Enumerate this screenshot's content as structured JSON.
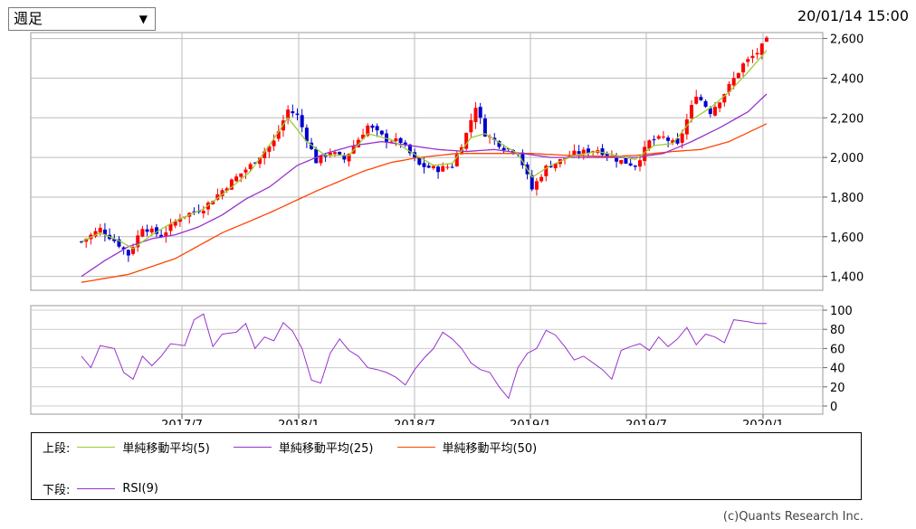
{
  "controls": {
    "period_select": "週足",
    "timestamp": "20/01/14 15:00"
  },
  "legend": {
    "upper_label": "上段:",
    "lower_label": "下段:",
    "items_upper": [
      {
        "label": "単純移動平均(5)",
        "color": "#9acd32"
      },
      {
        "label": "単純移動平均(25)",
        "color": "#9932cc"
      },
      {
        "label": "単純移動平均(50)",
        "color": "#ff4500"
      }
    ],
    "items_lower": [
      {
        "label": "RSI(9)",
        "color": "#9932cc"
      }
    ]
  },
  "copyright": "(c)Quants Research Inc.",
  "chart_data": [
    {
      "type": "candlestick",
      "ylim": [
        1330,
        2630
      ],
      "y_ticks": [
        "2,600",
        "2,400",
        "2,200",
        "2,000",
        "1,800",
        "1,600",
        "1,400"
      ],
      "y_tick_values": [
        2600,
        2400,
        2200,
        2000,
        1800,
        1600,
        1400
      ],
      "x_tick_labels": [
        "2017/7",
        "2018/1",
        "2018/7",
        "2019/1",
        "2019/7",
        "2020/1"
      ],
      "up_color": "#ff0000",
      "down_color": "#0000cd",
      "close_anchors": [
        [
          0,
          1575
        ],
        [
          4,
          1640
        ],
        [
          8,
          1560
        ],
        [
          10,
          1510
        ],
        [
          13,
          1650
        ],
        [
          17,
          1605
        ],
        [
          21,
          1700
        ],
        [
          26,
          1745
        ],
        [
          32,
          1880
        ],
        [
          36,
          1960
        ],
        [
          41,
          2080
        ],
        [
          44,
          2240
        ],
        [
          46,
          2210
        ],
        [
          50,
          1980
        ],
        [
          53,
          2030
        ],
        [
          56,
          1990
        ],
        [
          61,
          2160
        ],
        [
          65,
          2090
        ],
        [
          68,
          2080
        ],
        [
          72,
          1960
        ],
        [
          76,
          1940
        ],
        [
          79,
          1960
        ],
        [
          82,
          2120
        ],
        [
          84,
          2260
        ],
        [
          86,
          2120
        ],
        [
          90,
          2050
        ],
        [
          93,
          2030
        ],
        [
          96,
          1840
        ],
        [
          99,
          1950
        ],
        [
          105,
          2020
        ],
        [
          110,
          2040
        ],
        [
          114,
          1990
        ],
        [
          118,
          1960
        ],
        [
          121,
          2080
        ],
        [
          124,
          2100
        ],
        [
          127,
          2060
        ],
        [
          131,
          2320
        ],
        [
          134,
          2230
        ],
        [
          136,
          2290
        ],
        [
          138,
          2360
        ],
        [
          141,
          2470
        ],
        [
          144,
          2530
        ],
        [
          146,
          2590
        ]
      ],
      "sma5_anchors": [
        [
          0,
          1575
        ],
        [
          4,
          1620
        ],
        [
          8,
          1580
        ],
        [
          11,
          1540
        ],
        [
          15,
          1610
        ],
        [
          20,
          1680
        ],
        [
          26,
          1740
        ],
        [
          32,
          1850
        ],
        [
          36,
          1930
        ],
        [
          40,
          2060
        ],
        [
          44,
          2200
        ],
        [
          48,
          2080
        ],
        [
          52,
          2010
        ],
        [
          57,
          2010
        ],
        [
          61,
          2120
        ],
        [
          66,
          2090
        ],
        [
          70,
          2030
        ],
        [
          75,
          1960
        ],
        [
          79,
          1970
        ],
        [
          83,
          2100
        ],
        [
          86,
          2120
        ],
        [
          90,
          2060
        ],
        [
          93,
          2020
        ],
        [
          96,
          1900
        ],
        [
          100,
          1960
        ],
        [
          105,
          2010
        ],
        [
          110,
          2030
        ],
        [
          114,
          2010
        ],
        [
          118,
          1990
        ],
        [
          122,
          2060
        ],
        [
          126,
          2070
        ],
        [
          130,
          2190
        ],
        [
          134,
          2250
        ],
        [
          138,
          2330
        ],
        [
          142,
          2430
        ],
        [
          146,
          2540
        ]
      ],
      "sma25_anchors": [
        [
          0,
          1400
        ],
        [
          5,
          1480
        ],
        [
          10,
          1550
        ],
        [
          15,
          1590
        ],
        [
          20,
          1610
        ],
        [
          25,
          1650
        ],
        [
          30,
          1710
        ],
        [
          35,
          1790
        ],
        [
          40,
          1850
        ],
        [
          46,
          1960
        ],
        [
          52,
          2020
        ],
        [
          58,
          2060
        ],
        [
          64,
          2080
        ],
        [
          70,
          2060
        ],
        [
          76,
          2040
        ],
        [
          82,
          2030
        ],
        [
          88,
          2040
        ],
        [
          94,
          2020
        ],
        [
          100,
          2000
        ],
        [
          106,
          2000
        ],
        [
          112,
          2000
        ],
        [
          118,
          2000
        ],
        [
          124,
          2020
        ],
        [
          130,
          2080
        ],
        [
          136,
          2150
        ],
        [
          142,
          2230
        ],
        [
          146,
          2320
        ]
      ],
      "sma50_anchors": [
        [
          0,
          1370
        ],
        [
          10,
          1410
        ],
        [
          20,
          1490
        ],
        [
          30,
          1620
        ],
        [
          40,
          1720
        ],
        [
          50,
          1830
        ],
        [
          60,
          1930
        ],
        [
          66,
          1975
        ],
        [
          72,
          2000
        ],
        [
          80,
          2020
        ],
        [
          88,
          2020
        ],
        [
          96,
          2020
        ],
        [
          104,
          2010
        ],
        [
          112,
          2005
        ],
        [
          118,
          2010
        ],
        [
          126,
          2030
        ],
        [
          132,
          2040
        ],
        [
          138,
          2080
        ],
        [
          146,
          2170
        ]
      ]
    },
    {
      "type": "line",
      "name": "RSI(9)",
      "ylim": [
        0,
        100
      ],
      "y_ticks": [
        "100",
        "80",
        "60",
        "40",
        "20",
        "0"
      ],
      "y_tick_values": [
        100,
        80,
        60,
        40,
        20,
        0
      ],
      "values_anchors": [
        [
          0,
          52
        ],
        [
          2,
          40
        ],
        [
          4,
          63
        ],
        [
          7,
          60
        ],
        [
          9,
          35
        ],
        [
          11,
          28
        ],
        [
          13,
          52
        ],
        [
          15,
          42
        ],
        [
          17,
          52
        ],
        [
          19,
          65
        ],
        [
          22,
          63
        ],
        [
          24,
          90
        ],
        [
          26,
          96
        ],
        [
          28,
          62
        ],
        [
          30,
          75
        ],
        [
          33,
          77
        ],
        [
          35,
          86
        ],
        [
          37,
          60
        ],
        [
          39,
          72
        ],
        [
          41,
          68
        ],
        [
          43,
          87
        ],
        [
          45,
          78
        ],
        [
          47,
          60
        ],
        [
          49,
          27
        ],
        [
          51,
          24
        ],
        [
          53,
          55
        ],
        [
          55,
          70
        ],
        [
          57,
          58
        ],
        [
          59,
          52
        ],
        [
          61,
          40
        ],
        [
          63,
          38
        ],
        [
          65,
          35
        ],
        [
          67,
          30
        ],
        [
          69,
          22
        ],
        [
          71,
          38
        ],
        [
          73,
          50
        ],
        [
          75,
          60
        ],
        [
          77,
          77
        ],
        [
          79,
          70
        ],
        [
          81,
          60
        ],
        [
          83,
          45
        ],
        [
          85,
          38
        ],
        [
          87,
          35
        ],
        [
          89,
          20
        ],
        [
          91,
          8
        ],
        [
          93,
          40
        ],
        [
          95,
          55
        ],
        [
          97,
          60
        ],
        [
          99,
          79
        ],
        [
          101,
          74
        ],
        [
          103,
          62
        ],
        [
          105,
          48
        ],
        [
          107,
          52
        ],
        [
          109,
          45
        ],
        [
          111,
          38
        ],
        [
          113,
          28
        ],
        [
          115,
          58
        ],
        [
          117,
          62
        ],
        [
          119,
          65
        ],
        [
          121,
          58
        ],
        [
          123,
          72
        ],
        [
          125,
          62
        ],
        [
          127,
          70
        ],
        [
          129,
          82
        ],
        [
          131,
          64
        ],
        [
          133,
          75
        ],
        [
          135,
          72
        ],
        [
          137,
          66
        ],
        [
          139,
          90
        ],
        [
          142,
          88
        ],
        [
          144,
          86
        ],
        [
          146,
          86
        ]
      ]
    }
  ]
}
